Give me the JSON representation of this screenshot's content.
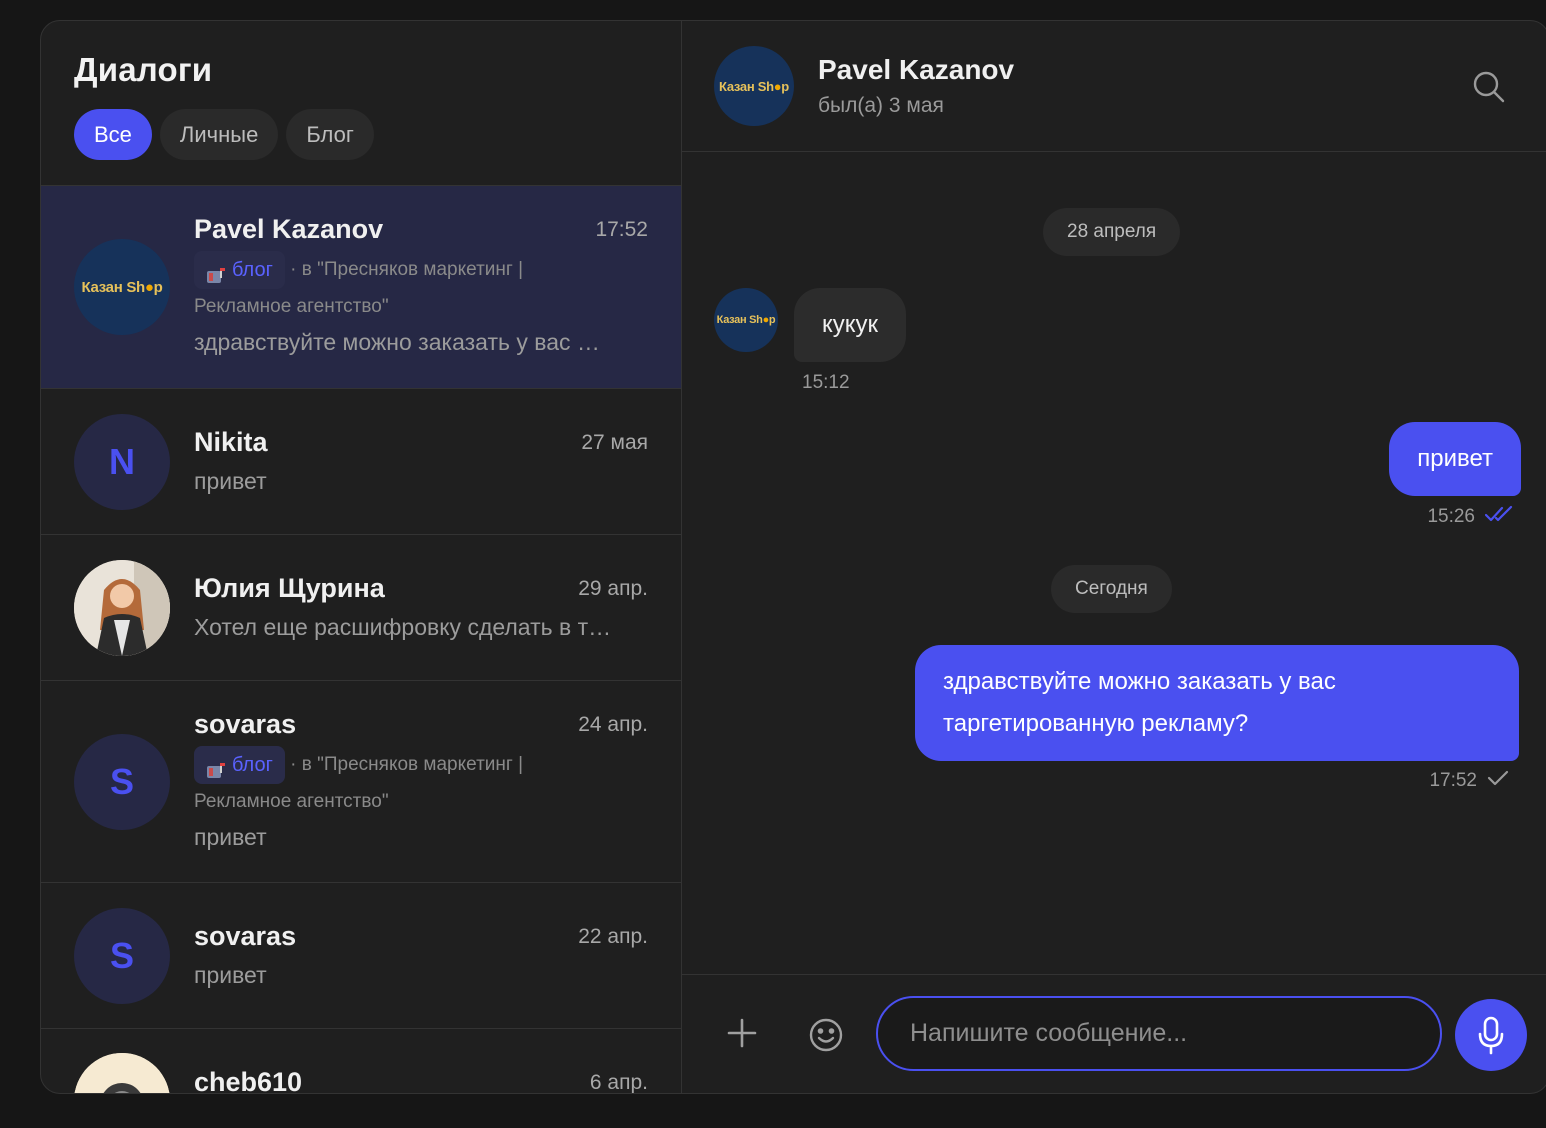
{
  "left": {
    "title": "Диалоги",
    "filters": [
      {
        "label": "Все",
        "active": true
      },
      {
        "label": "Личные",
        "active": false
      },
      {
        "label": "Блог",
        "active": false
      }
    ]
  },
  "brand_logo": {
    "part1": "Казан Sh",
    "part2": "●",
    "part3": "p"
  },
  "dialogs": [
    {
      "name": "Pavel Kazanov",
      "time": "17:52",
      "tag": "блог",
      "context": "· в \"Пресняков маркетинг | Рекламное агентство\"",
      "message": "здравствуйте можно заказать у вас …"
    },
    {
      "name": "Nikita",
      "time": "27 мая",
      "letter": "N",
      "message": "привет"
    },
    {
      "name": "Юлия Щурина",
      "time": "29 апр.",
      "message": "Хотел еще расшифровку сделать в т…"
    },
    {
      "name": "sovaras",
      "time": "24 апр.",
      "letter": "S",
      "tag": "блог",
      "context": "· в \"Пресняков маркетинг | Рекламное агентство\"",
      "message": "привет"
    },
    {
      "name": "sovaras",
      "time": "22 апр.",
      "letter": "S",
      "message": "привет"
    },
    {
      "name": "cheb610",
      "time": "6 апр."
    }
  ],
  "chat": {
    "name": "Pavel Kazanov",
    "status": "был(а) 3 мая",
    "dates": [
      "28 апреля",
      "Сегодня"
    ],
    "messages": [
      {
        "direction": "in",
        "text": "кукук",
        "time": "15:12"
      },
      {
        "direction": "out",
        "text": "привет",
        "time": "15:26",
        "status": "read"
      },
      {
        "direction": "out",
        "text": "здравствуйте можно заказать у вас таргетированную рекламу?",
        "time": "17:52",
        "status": "sent"
      }
    ]
  },
  "composer": {
    "placeholder": "Напишите сообщение..."
  },
  "colors": {
    "accent": "#4a50f0",
    "background": "#1f1f1f",
    "active_row": "#262845"
  }
}
